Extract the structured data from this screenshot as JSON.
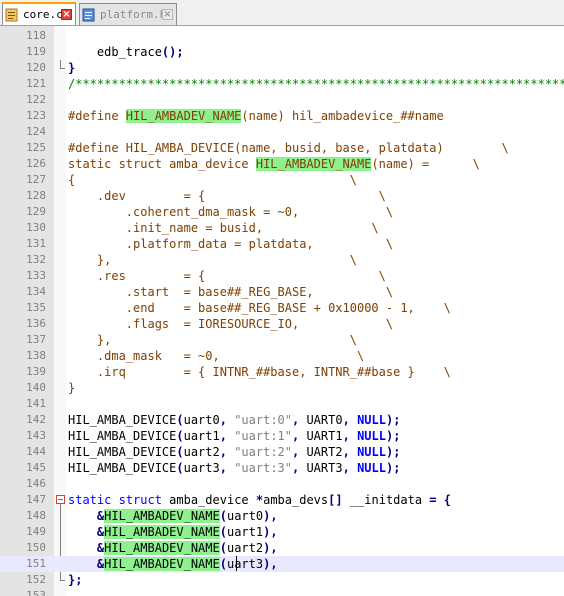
{
  "tabs": [
    {
      "label": "core.c",
      "active": true
    },
    {
      "label": "platform.h",
      "active": false
    }
  ],
  "lines": [
    {
      "n": "118",
      "tokens": []
    },
    {
      "n": "119",
      "tokens": [
        {
          "t": "    edb_trace"
        },
        {
          "t": "(",
          "c": "op"
        },
        {
          "t": ")",
          "c": "op"
        },
        {
          "t": ";",
          "c": "op"
        }
      ]
    },
    {
      "n": "120",
      "tokens": [
        {
          "t": "}",
          "c": "op"
        }
      ]
    },
    {
      "n": "121",
      "tokens": [
        {
          "t": "/******************************************************************************",
          "c": "cmt"
        }
      ]
    },
    {
      "n": "122",
      "tokens": []
    },
    {
      "n": "123",
      "tokens": [
        {
          "t": "#define ",
          "c": "pre"
        },
        {
          "t": "HIL_AMBADEV_NAME",
          "c": "pre hl"
        },
        {
          "t": "(name) hil_ambadevice_##name",
          "c": "pre"
        }
      ]
    },
    {
      "n": "124",
      "tokens": []
    },
    {
      "n": "125",
      "tokens": [
        {
          "t": "#define HIL_AMBA_DEVICE(name, busid, base, platdata)        \\",
          "c": "pre"
        }
      ]
    },
    {
      "n": "126",
      "tokens": [
        {
          "t": "static struct amba_device ",
          "c": "pre"
        },
        {
          "t": "HIL_AMBADEV_NAME",
          "c": "pre hl"
        },
        {
          "t": "(name) =      \\",
          "c": "pre"
        }
      ]
    },
    {
      "n": "127",
      "tokens": [
        {
          "t": "{                                      \\",
          "c": "pre"
        }
      ]
    },
    {
      "n": "128",
      "tokens": [
        {
          "t": "    .dev        = {                        \\",
          "c": "pre"
        }
      ]
    },
    {
      "n": "129",
      "tokens": [
        {
          "t": "        .coherent_dma_mask = ~0,            \\",
          "c": "pre"
        }
      ]
    },
    {
      "n": "130",
      "tokens": [
        {
          "t": "        .init_name = busid,               \\",
          "c": "pre"
        }
      ]
    },
    {
      "n": "131",
      "tokens": [
        {
          "t": "        .platform_data = platdata,          \\",
          "c": "pre"
        }
      ]
    },
    {
      "n": "132",
      "tokens": [
        {
          "t": "    },                                 \\",
          "c": "pre"
        }
      ]
    },
    {
      "n": "133",
      "tokens": [
        {
          "t": "    .res        = {                        \\",
          "c": "pre"
        }
      ]
    },
    {
      "n": "134",
      "tokens": [
        {
          "t": "        .start  = base##_REG_BASE,          \\",
          "c": "pre"
        }
      ]
    },
    {
      "n": "135",
      "tokens": [
        {
          "t": "        .end    = base##_REG_BASE + 0x10000 - 1,    \\",
          "c": "pre"
        }
      ]
    },
    {
      "n": "136",
      "tokens": [
        {
          "t": "        .flags  = IORESOURCE_IO,            \\",
          "c": "pre"
        }
      ]
    },
    {
      "n": "137",
      "tokens": [
        {
          "t": "    },                                 \\",
          "c": "pre"
        }
      ]
    },
    {
      "n": "138",
      "tokens": [
        {
          "t": "    .dma_mask   = ~0,                   \\",
          "c": "pre"
        }
      ]
    },
    {
      "n": "139",
      "tokens": [
        {
          "t": "    .irq        = { INTNR_##base, INTNR_##base }    \\",
          "c": "pre"
        }
      ]
    },
    {
      "n": "140",
      "tokens": [
        {
          "t": "}",
          "c": "pre"
        }
      ]
    },
    {
      "n": "141",
      "tokens": []
    },
    {
      "n": "142",
      "tokens": [
        {
          "t": "HIL_AMBA_DEVICE"
        },
        {
          "t": "(",
          "c": "op"
        },
        {
          "t": "uart0"
        },
        {
          "t": ",",
          "c": "op"
        },
        {
          "t": " "
        },
        {
          "t": "\"uart:0\"",
          "c": "str"
        },
        {
          "t": ",",
          "c": "op"
        },
        {
          "t": " UART0"
        },
        {
          "t": ",",
          "c": "op"
        },
        {
          "t": " "
        },
        {
          "t": "NULL",
          "c": "lit"
        },
        {
          "t": ")",
          "c": "op"
        },
        {
          "t": ";",
          "c": "op"
        }
      ]
    },
    {
      "n": "143",
      "tokens": [
        {
          "t": "HIL_AMBA_DEVICE"
        },
        {
          "t": "(",
          "c": "op"
        },
        {
          "t": "uart1"
        },
        {
          "t": ",",
          "c": "op"
        },
        {
          "t": " "
        },
        {
          "t": "\"uart:1\"",
          "c": "str"
        },
        {
          "t": ",",
          "c": "op"
        },
        {
          "t": " UART1"
        },
        {
          "t": ",",
          "c": "op"
        },
        {
          "t": " "
        },
        {
          "t": "NULL",
          "c": "lit"
        },
        {
          "t": ")",
          "c": "op"
        },
        {
          "t": ";",
          "c": "op"
        }
      ]
    },
    {
      "n": "144",
      "tokens": [
        {
          "t": "HIL_AMBA_DEVICE"
        },
        {
          "t": "(",
          "c": "op"
        },
        {
          "t": "uart2"
        },
        {
          "t": ",",
          "c": "op"
        },
        {
          "t": " "
        },
        {
          "t": "\"uart:2\"",
          "c": "str"
        },
        {
          "t": ",",
          "c": "op"
        },
        {
          "t": " UART2"
        },
        {
          "t": ",",
          "c": "op"
        },
        {
          "t": " "
        },
        {
          "t": "NULL",
          "c": "lit"
        },
        {
          "t": ")",
          "c": "op"
        },
        {
          "t": ";",
          "c": "op"
        }
      ]
    },
    {
      "n": "145",
      "tokens": [
        {
          "t": "HIL_AMBA_DEVICE"
        },
        {
          "t": "(",
          "c": "op"
        },
        {
          "t": "uart3"
        },
        {
          "t": ",",
          "c": "op"
        },
        {
          "t": " "
        },
        {
          "t": "\"uart:3\"",
          "c": "str"
        },
        {
          "t": ",",
          "c": "op"
        },
        {
          "t": " UART3"
        },
        {
          "t": ",",
          "c": "op"
        },
        {
          "t": " "
        },
        {
          "t": "NULL",
          "c": "lit"
        },
        {
          "t": ")",
          "c": "op"
        },
        {
          "t": ";",
          "c": "op"
        }
      ]
    },
    {
      "n": "146",
      "tokens": []
    },
    {
      "n": "147",
      "tokens": [
        {
          "t": "static",
          "c": "kw"
        },
        {
          "t": " "
        },
        {
          "t": "struct",
          "c": "kw"
        },
        {
          "t": " amba_device "
        },
        {
          "t": "*",
          "c": "op"
        },
        {
          "t": "amba_devs"
        },
        {
          "t": "[]",
          "c": "op"
        },
        {
          "t": " __initdata "
        },
        {
          "t": "=",
          "c": "op"
        },
        {
          "t": " "
        },
        {
          "t": "{",
          "c": "op"
        }
      ]
    },
    {
      "n": "148",
      "tokens": [
        {
          "t": "    "
        },
        {
          "t": "&",
          "c": "op"
        },
        {
          "t": "HIL_AMBADEV_NAME",
          "c": "hl"
        },
        {
          "t": "(",
          "c": "op"
        },
        {
          "t": "uart0"
        },
        {
          "t": ")",
          "c": "op"
        },
        {
          "t": ",",
          "c": "op"
        }
      ]
    },
    {
      "n": "149",
      "tokens": [
        {
          "t": "    "
        },
        {
          "t": "&",
          "c": "op"
        },
        {
          "t": "HIL_AMBADEV_NAME",
          "c": "hl"
        },
        {
          "t": "(",
          "c": "op"
        },
        {
          "t": "uart1"
        },
        {
          "t": ")",
          "c": "op"
        },
        {
          "t": ",",
          "c": "op"
        }
      ]
    },
    {
      "n": "150",
      "tokens": [
        {
          "t": "    "
        },
        {
          "t": "&",
          "c": "op"
        },
        {
          "t": "HIL_AMBADEV_NAME",
          "c": "hl"
        },
        {
          "t": "(",
          "c": "op"
        },
        {
          "t": "uart2"
        },
        {
          "t": ")",
          "c": "op"
        },
        {
          "t": ",",
          "c": "op"
        }
      ]
    },
    {
      "n": "151",
      "tokens": [
        {
          "t": "    "
        },
        {
          "t": "&",
          "c": "op"
        },
        {
          "t": "HIL_AMBADEV_NAME",
          "c": "hl"
        },
        {
          "t": "(",
          "c": "op"
        },
        {
          "t": "uart3"
        },
        {
          "t": ")",
          "c": "op"
        },
        {
          "t": ",",
          "c": "op"
        }
      ],
      "current": true
    },
    {
      "n": "152",
      "tokens": [
        {
          "t": "}",
          "c": "op"
        },
        {
          "t": ";",
          "c": "op"
        }
      ]
    },
    {
      "n": "153",
      "tokens": []
    }
  ],
  "colors": {
    "highlight": "#8ef08e",
    "current_line": "#e8e8ff",
    "keyword": "#0000ff",
    "preprocessor": "#804000",
    "comment": "#008000",
    "string": "#808080",
    "operator": "#000080"
  }
}
